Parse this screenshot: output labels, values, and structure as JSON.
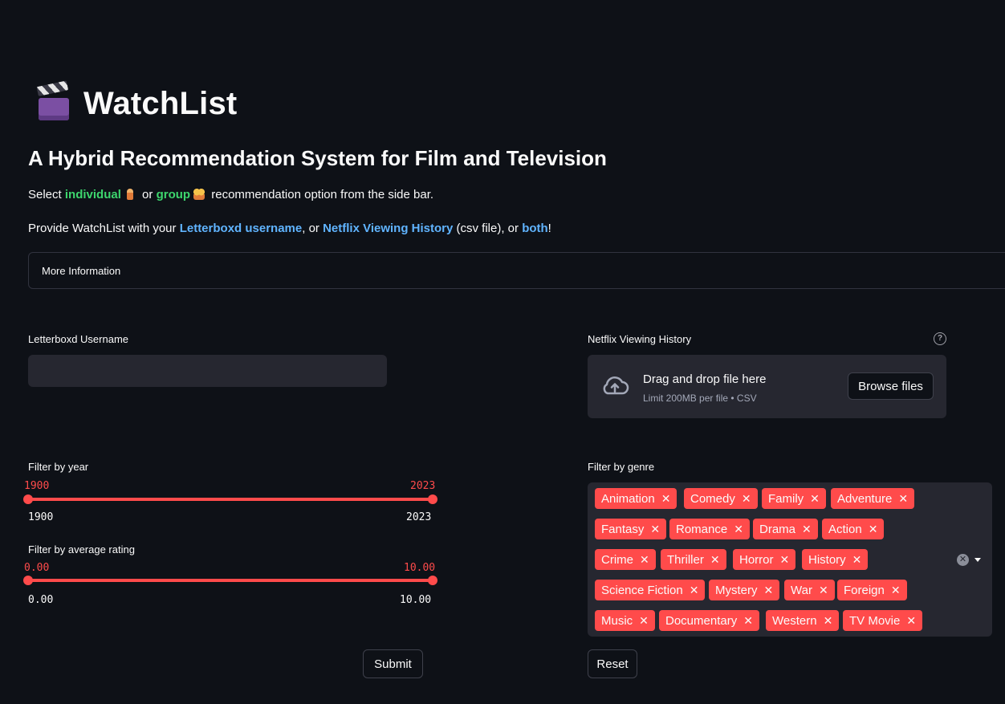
{
  "app": {
    "title": "WatchList",
    "subtitle": "A Hybrid Recommendation System for Film and Television"
  },
  "intro": {
    "line1": {
      "pre": "Select ",
      "individual": "individual",
      "mid": " or ",
      "group": "group",
      "post": " recommendation option from the side bar."
    },
    "line2": {
      "pre": "Provide WatchList with your ",
      "letterboxd": "Letterboxd username",
      "mid": ", or ",
      "netflix": "Netflix Viewing History",
      "mid2": " (csv file), or ",
      "both": "both",
      "post": "!"
    }
  },
  "expander": {
    "label": "More Information"
  },
  "letterboxd": {
    "label": "Letterboxd Username",
    "value": ""
  },
  "netflix": {
    "label": "Netflix Viewing History",
    "drop_title": "Drag and drop file here",
    "drop_sub": "Limit 200MB per file • CSV",
    "browse_label": "Browse files"
  },
  "year_filter": {
    "label": "Filter by year",
    "low": "1900",
    "high": "2023",
    "min": "1900",
    "max": "2023"
  },
  "rating_filter": {
    "label": "Filter by average rating",
    "low": "0.00",
    "high": "10.00",
    "min": "0.00",
    "max": "10.00"
  },
  "genre_filter": {
    "label": "Filter by genre",
    "tags": [
      "Animation",
      "Comedy",
      "Family",
      "Adventure",
      "Fantasy",
      "Romance",
      "Drama",
      "Action",
      "Crime",
      "Thriller",
      "Horror",
      "History",
      "Science Fiction",
      "Mystery",
      "War",
      "Foreign",
      "Music",
      "Documentary",
      "Western",
      "TV Movie"
    ]
  },
  "buttons": {
    "submit": "Submit",
    "reset": "Reset"
  },
  "colors": {
    "accent": "#ff4b4b",
    "green": "#3dd56d",
    "blue": "#60b4ff",
    "background": "#0e1117",
    "input": "#262730"
  }
}
